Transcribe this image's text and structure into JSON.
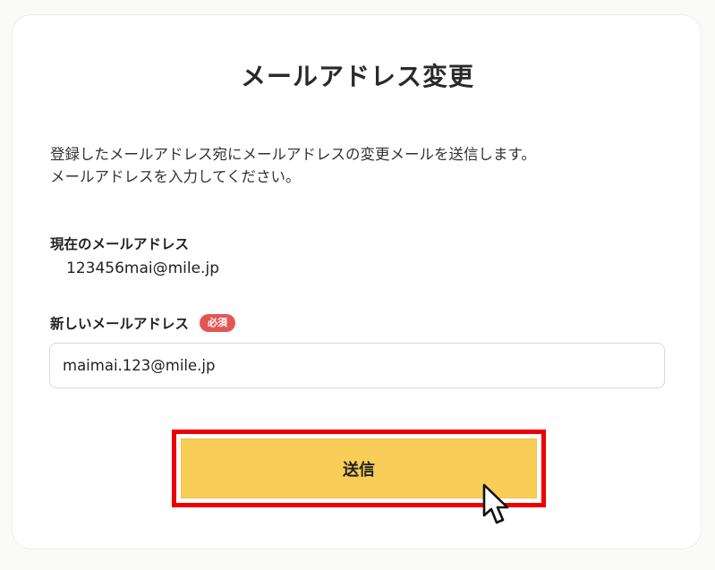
{
  "page": {
    "title": "メールアドレス変更",
    "description_lines": [
      "登録したメールアドレス宛にメールアドレスの変更メールを送信します。",
      "メールアドレスを入力してください。"
    ]
  },
  "current_email": {
    "label": "現在のメールアドレス",
    "value": "123456mai@mile.jp"
  },
  "new_email": {
    "label": "新しいメールアドレス",
    "required_badge": "必須",
    "value": "maimai.123@mile.jp",
    "placeholder": ""
  },
  "submit": {
    "label": "送信"
  },
  "colors": {
    "button_background": "#f9ce58",
    "highlight_frame": "#ee0000",
    "required_badge": "#e45654"
  },
  "icons": {
    "pointer": "mouse-pointer-icon"
  }
}
